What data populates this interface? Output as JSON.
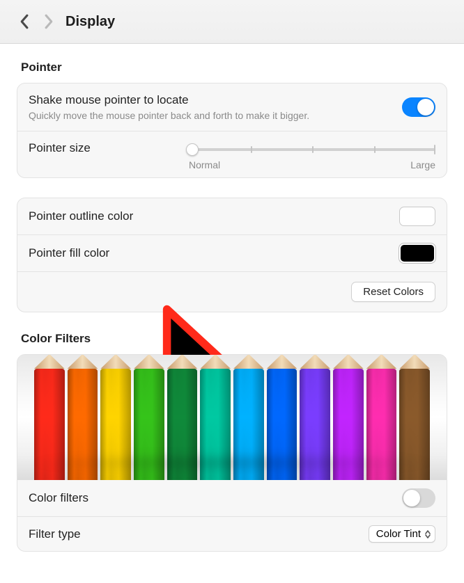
{
  "header": {
    "title": "Display"
  },
  "pointer": {
    "section_title": "Pointer",
    "shake": {
      "label": "Shake mouse pointer to locate",
      "desc": "Quickly move the mouse pointer back and forth to make it bigger.",
      "on": true
    },
    "size": {
      "label": "Pointer size",
      "min_label": "Normal",
      "max_label": "Large",
      "value_percent": 0
    },
    "outline": {
      "label": "Pointer outline color",
      "color": "#ffffff"
    },
    "fill": {
      "label": "Pointer fill color",
      "color": "#000000"
    },
    "reset_label": "Reset Colors",
    "preview": {
      "fill": "#000000",
      "outline": "#ff2a1a"
    }
  },
  "color_filters": {
    "section_title": "Color Filters",
    "pencil_colors": [
      "#ff2a1a",
      "#ff6a00",
      "#ffd400",
      "#35c41a",
      "#0f8a3a",
      "#00c9a2",
      "#00b2ff",
      "#0068ff",
      "#7a3dff",
      "#c224ff",
      "#ff2db0",
      "#8b5a2b"
    ],
    "toggle": {
      "label": "Color filters",
      "on": false
    },
    "filter_type": {
      "label": "Filter type",
      "value": "Color Tint"
    }
  }
}
